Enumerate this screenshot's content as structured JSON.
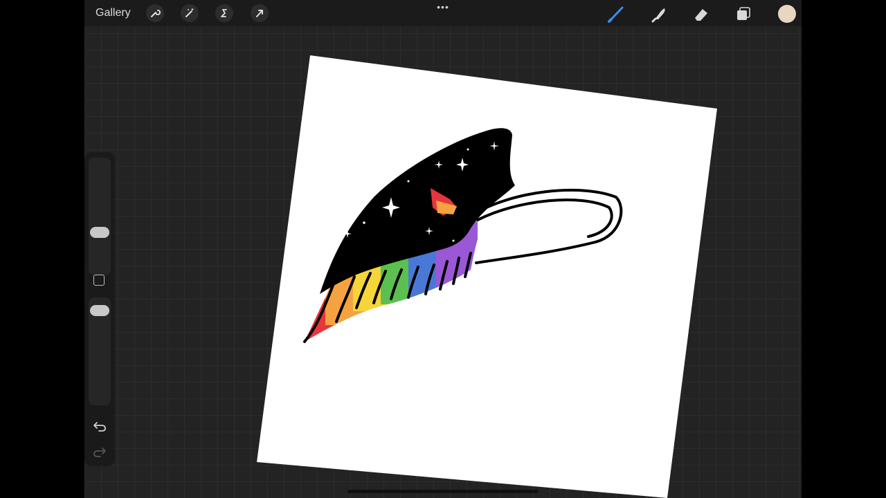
{
  "topbar": {
    "gallery_label": "Gallery",
    "left_tools": [
      {
        "name": "actions",
        "icon": "wrench-icon"
      },
      {
        "name": "adjustments",
        "icon": "magic-wand-icon"
      },
      {
        "name": "selection",
        "icon": "selection-s-icon"
      },
      {
        "name": "transform",
        "icon": "arrow-cursor-icon"
      }
    ],
    "more_label": "•••",
    "right_tools": [
      {
        "name": "brush",
        "icon": "brush-icon",
        "active": true
      },
      {
        "name": "smudge",
        "icon": "smudge-finger-icon",
        "active": false
      },
      {
        "name": "eraser",
        "icon": "eraser-icon",
        "active": false
      },
      {
        "name": "layers",
        "icon": "layers-icon",
        "active": false
      }
    ],
    "current_color": "#e8d6c2"
  },
  "sidebar": {
    "icons": [
      "undo-icon",
      "redo-icon",
      "modify-square-icon"
    ]
  },
  "colors": {
    "accent": "#3a8ee6",
    "toolbar_bg": "#1b1b1b",
    "canvas_bg": "#232323",
    "paper": "#ffffff"
  }
}
